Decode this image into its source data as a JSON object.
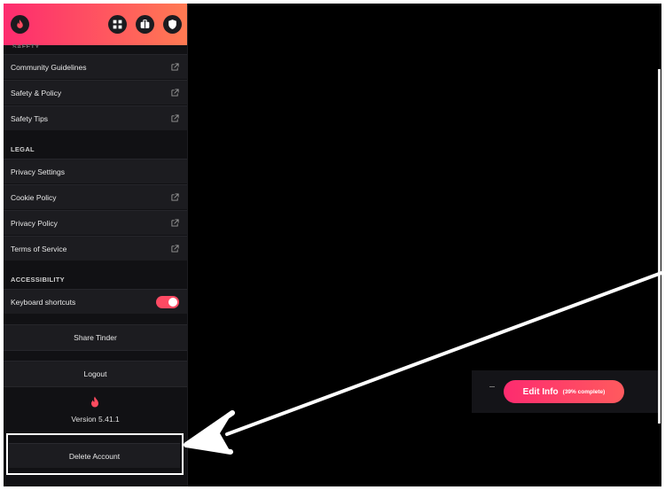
{
  "sidebar": {
    "safety_label": "SAFETY",
    "safety_items": [
      {
        "label": "Community Guidelines"
      },
      {
        "label": "Safety & Policy"
      },
      {
        "label": "Safety Tips"
      }
    ],
    "legal_label": "LEGAL",
    "legal_items": [
      {
        "label": "Privacy Settings"
      },
      {
        "label": "Cookie Policy"
      },
      {
        "label": "Privacy Policy"
      },
      {
        "label": "Terms of Service"
      }
    ],
    "accessibility_label": "ACCESSIBILITY",
    "keyboard_shortcuts": {
      "label": "Keyboard shortcuts",
      "enabled": true
    },
    "share_label": "Share Tinder",
    "logout_label": "Logout",
    "version": "Version 5.41.1",
    "delete_label": "Delete Account"
  },
  "profile_card": {
    "edit_label": "Edit Info",
    "edit_progress": "(39% complete)"
  },
  "colors": {
    "brand_start": "#fd2b6f",
    "brand_end": "#ff7a52",
    "toggle_on": "#fd4a63"
  }
}
